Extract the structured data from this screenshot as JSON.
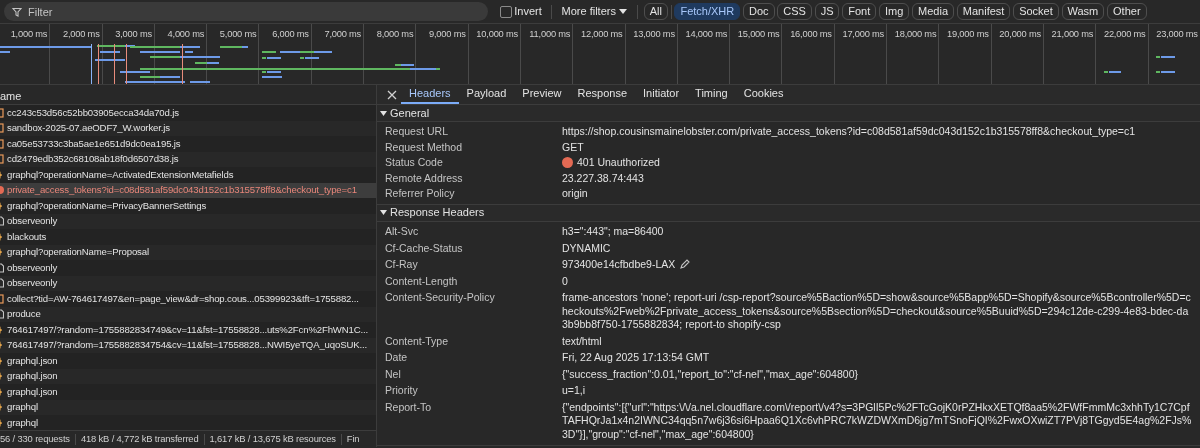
{
  "filter_bar": {
    "placeholder": "Filter",
    "invert": {
      "label": "Invert",
      "checked": false
    },
    "more_filters": "More filters",
    "type_filters": [
      {
        "label": "All",
        "selected": false
      },
      {
        "label": "Fetch/XHR",
        "selected": true
      },
      {
        "label": "Doc",
        "selected": false
      },
      {
        "label": "CSS",
        "selected": false
      },
      {
        "label": "JS",
        "selected": false
      },
      {
        "label": "Font",
        "selected": false
      },
      {
        "label": "Img",
        "selected": false
      },
      {
        "label": "Media",
        "selected": false
      },
      {
        "label": "Manifest",
        "selected": false
      },
      {
        "label": "Socket",
        "selected": false
      },
      {
        "label": "Wasm",
        "selected": false
      },
      {
        "label": "Other",
        "selected": false
      }
    ]
  },
  "timeline": {
    "ticks": [
      "1,000 ms",
      "2,000 ms",
      "3,000 ms",
      "4,000 ms",
      "5,000 ms",
      "6,000 ms",
      "7,000 ms",
      "8,000 ms",
      "9,000 ms",
      "10,000 ms",
      "11,000 ms",
      "12,000 ms",
      "13,000 ms",
      "14,000 ms",
      "15,000 ms",
      "16,000 ms",
      "17,000 ms",
      "18,000 ms",
      "19,000 ms",
      "20,000 ms",
      "21,000 ms",
      "22,000 ms",
      "23,000 ms"
    ]
  },
  "request_list": {
    "column_header": "ame",
    "rows": [
      {
        "name": "cc243c53d56c52bb03905ecca34da70d.js",
        "kind": "script",
        "selected": false
      },
      {
        "name": "sandbox-2025-07.aeODF7_W.worker.js",
        "kind": "script",
        "selected": false
      },
      {
        "name": "ca05e53733c3ba5ae1e651d9dc0ea195.js",
        "kind": "script",
        "selected": false
      },
      {
        "name": "cd2479edb352c68108ab18f0d6507d38.js",
        "kind": "script",
        "selected": false
      },
      {
        "name": "graphql?operationName=ActivatedExtensionMetafields",
        "kind": "xhr",
        "selected": false
      },
      {
        "name": "private_access_tokens?id=c08d581af59dc043d152c1b315578ff8&checkout_type=c1",
        "kind": "error",
        "selected": true
      },
      {
        "name": "graphql?operationName=PrivacyBannerSettings",
        "kind": "xhr",
        "selected": false
      },
      {
        "name": "observeonly",
        "kind": "doc",
        "selected": false
      },
      {
        "name": "blackouts",
        "kind": "xhr",
        "selected": false
      },
      {
        "name": "graphql?operationName=Proposal",
        "kind": "xhr",
        "selected": false
      },
      {
        "name": "observeonly",
        "kind": "doc",
        "selected": false
      },
      {
        "name": "observeonly",
        "kind": "doc",
        "selected": false
      },
      {
        "name": "collect?tid=AW-764617497&en=page_view&dr=shop.cous...05399923&tft=1755882...",
        "kind": "script",
        "selected": false
      },
      {
        "name": "produce",
        "kind": "doc",
        "selected": false
      },
      {
        "name": "764617497/?random=1755882834749&cv=11&fst=17558828...uts%2Fcn%2FhWN1C...",
        "kind": "xhr",
        "selected": false
      },
      {
        "name": "764617497/?random=1755882834754&cv=11&fst=17558828...NWI5yeTQA_uqoSUK...",
        "kind": "xhr",
        "selected": false
      },
      {
        "name": "graphql.json",
        "kind": "xhr",
        "selected": false
      },
      {
        "name": "graphql.json",
        "kind": "xhr",
        "selected": false
      },
      {
        "name": "graphql.json",
        "kind": "xhr",
        "selected": false
      },
      {
        "name": "graphql",
        "kind": "xhr",
        "selected": false
      },
      {
        "name": "graphql",
        "kind": "xhr",
        "selected": false
      }
    ]
  },
  "status_bar": [
    "56 / 330 requests",
    "418 kB / 4,772 kB transferred",
    "1,617 kB / 13,675 kB resources",
    "Fin"
  ],
  "details": {
    "tabs": [
      {
        "label": "Headers",
        "selected": true
      },
      {
        "label": "Payload",
        "selected": false
      },
      {
        "label": "Preview",
        "selected": false
      },
      {
        "label": "Response",
        "selected": false
      },
      {
        "label": "Initiator",
        "selected": false
      },
      {
        "label": "Timing",
        "selected": false
      },
      {
        "label": "Cookies",
        "selected": false
      }
    ],
    "sections": [
      {
        "title": "General",
        "expanded": true,
        "rows": [
          {
            "name": "Request URL",
            "value": "https://shop.cousinsmainelobster.com/private_access_tokens?id=c08d581af59dc043d152c1b315578ff8&checkout_type=c1",
            "kind": "plain"
          },
          {
            "name": "Request Method",
            "value": "GET",
            "kind": "plain"
          },
          {
            "name": "Status Code",
            "value": "401 Unauthorized",
            "kind": "status",
            "color": "#e46a54"
          },
          {
            "name": "Remote Address",
            "value": "23.227.38.74:443",
            "kind": "plain"
          },
          {
            "name": "Referrer Policy",
            "value": "origin",
            "kind": "plain"
          }
        ]
      },
      {
        "title": "Response Headers",
        "expanded": true,
        "rows": [
          {
            "name": "Alt-Svc",
            "value": "h3=\":443\"; ma=86400",
            "kind": "plain"
          },
          {
            "name": "Cf-Cache-Status",
            "value": "DYNAMIC",
            "kind": "plain"
          },
          {
            "name": "Cf-Ray",
            "value": "973400e14cfbdbe9-LAX",
            "kind": "editable"
          },
          {
            "name": "Content-Length",
            "value": "0",
            "kind": "plain"
          },
          {
            "name": "Content-Security-Policy",
            "value": "frame-ancestors 'none'; report-uri /csp-report?source%5Baction%5D=show&source%5Bapp%5D=Shopify&source%5Bcontroller%5D=checkouts%2Fweb%2Fprivate_access_tokens&source%5Bsection%5D=checkout&source%5Buuid%5D=294c12de-c299-4e83-bdec-da3b9bb8f750-1755882834; report-to shopify-csp",
            "kind": "plain"
          },
          {
            "name": "Content-Type",
            "value": "text/html",
            "kind": "plain"
          },
          {
            "name": "Date",
            "value": "Fri, 22 Aug 2025 17:13:54 GMT",
            "kind": "plain"
          },
          {
            "name": "Nel",
            "value": "{\"success_fraction\":0.01,\"report_to\":\"cf-nel\",\"max_age\":604800}",
            "kind": "plain"
          },
          {
            "name": "Priority",
            "value": "u=1,i",
            "kind": "plain"
          },
          {
            "name": "Report-To",
            "value": "{\"endpoints\":[{\"url\":\"https:\\/\\/a.nel.cloudflare.com\\/report\\/v4?s=3PGlI5Pc%2FTcGojK0rPZHkxXETQf8aa5%2FWfFmmMc3xhhTy1C7CpfTAFHQrJa1x4n2IWNC34qq5n7w6j36si6Hpaa6Q1Xc6vhPRC7kWZDWXmD6jg7mTSnoFjQI%2FwxOXwiZT7PVj8TGgyd5E4ag%2FJs%3D\"}],\"group\":\"cf-nel\",\"max_age\":604800}",
            "kind": "plain"
          }
        ]
      }
    ]
  }
}
